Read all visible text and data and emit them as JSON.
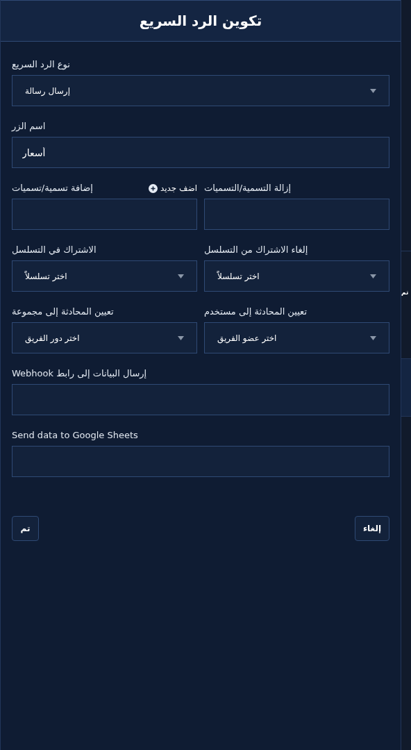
{
  "dialog": {
    "title": "تكوين الرد السريع"
  },
  "rows": [
    [
      {
        "kind": "select",
        "label": "نوع الرد السريع",
        "value": "إرسال رسالة"
      }
    ],
    [
      {
        "kind": "text",
        "label": "اسم الزر",
        "value": "أسعار"
      }
    ],
    [
      {
        "kind": "text",
        "label": "إزالة التسمية/التسميات"
      },
      {
        "kind": "text",
        "label": "إضافة تسمية/تسميات",
        "action": "اضف جديد"
      }
    ],
    [
      {
        "kind": "select",
        "label": "إلغاء الاشتراك من التسلسل",
        "value": "اختر تسلسلاً"
      },
      {
        "kind": "select",
        "label": "الاشتراك في التسلسل",
        "value": "اختر تسلسلاً"
      }
    ],
    [
      {
        "kind": "select",
        "label": "تعيين المحادثة إلى مستخدم",
        "value": "اختر عضو الفريق"
      },
      {
        "kind": "select",
        "label": "تعيين المحادثة إلى مجموعة",
        "value": "اختر دور الفريق"
      }
    ],
    [
      {
        "kind": "text",
        "label": "إرسال البيانات إلى رابط Webhook"
      }
    ],
    [
      {
        "kind": "text",
        "label": "Send data to Google Sheets"
      }
    ]
  ],
  "buttons": [
    {
      "label": "إلغاء"
    },
    {
      "label": "تم"
    }
  ],
  "side": {
    "button": "تم"
  }
}
